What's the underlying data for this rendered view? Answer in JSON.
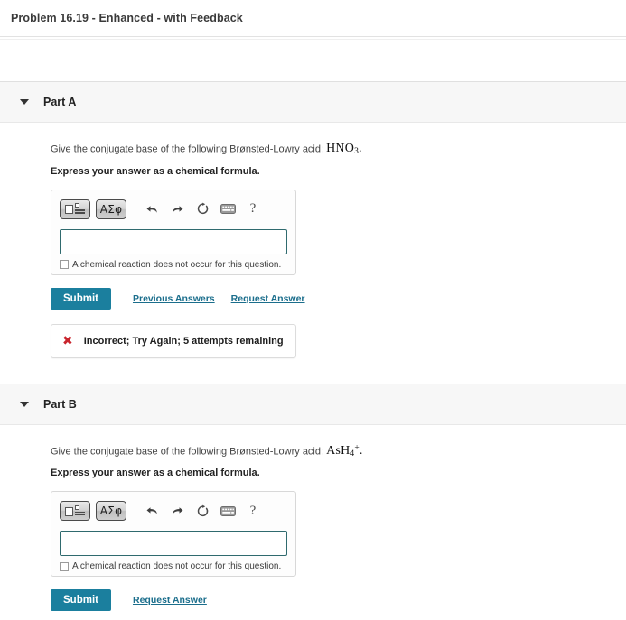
{
  "page": {
    "title": "Problem 16.19 - Enhanced - with Feedback"
  },
  "colors": {
    "submit_button": "#1b7f9e",
    "link": "#1b6e8c",
    "input_border": "#2f6a6e",
    "error": "#c9252d",
    "part_header_bg": "#f7f7f7"
  },
  "toolbar": {
    "template_button_name": "template-button",
    "sigma_label": "ΑΣφ",
    "undo_icon": "undo-arrow-icon",
    "redo_icon": "redo-arrow-icon",
    "reset_icon": "reset-circular-arrow-icon",
    "keyboard_icon": "keyboard-icon",
    "help_label": "?"
  },
  "answer_widget": {
    "input_value": "",
    "input_placeholder": "",
    "no_reaction_label": "A chemical reaction does not occur for this question.",
    "no_reaction_checked": false
  },
  "parts": [
    {
      "id": "part-a",
      "label": "Part A",
      "expanded": true,
      "question_prefix": "Give the conjugate base of the following Brønsted-Lowry acid:",
      "formula": {
        "base": "HNO",
        "sub": "3",
        "sup": "",
        "trailing": "."
      },
      "instruction": "Express your answer as a chemical formula.",
      "submit_label": "Submit",
      "links": [
        "Previous Answers",
        "Request Answer"
      ],
      "feedback": {
        "icon": "red-x-icon",
        "text": "Incorrect; Try Again; 5 attempts remaining"
      }
    },
    {
      "id": "part-b",
      "label": "Part B",
      "expanded": true,
      "question_prefix": "Give the conjugate base of the following Brønsted-Lowry acid:",
      "formula": {
        "base": "AsH",
        "sub": "4",
        "sup": "+",
        "trailing": "."
      },
      "instruction": "Express your answer as a chemical formula.",
      "submit_label": "Submit",
      "links": [
        "Request Answer"
      ],
      "feedback": null
    }
  ]
}
